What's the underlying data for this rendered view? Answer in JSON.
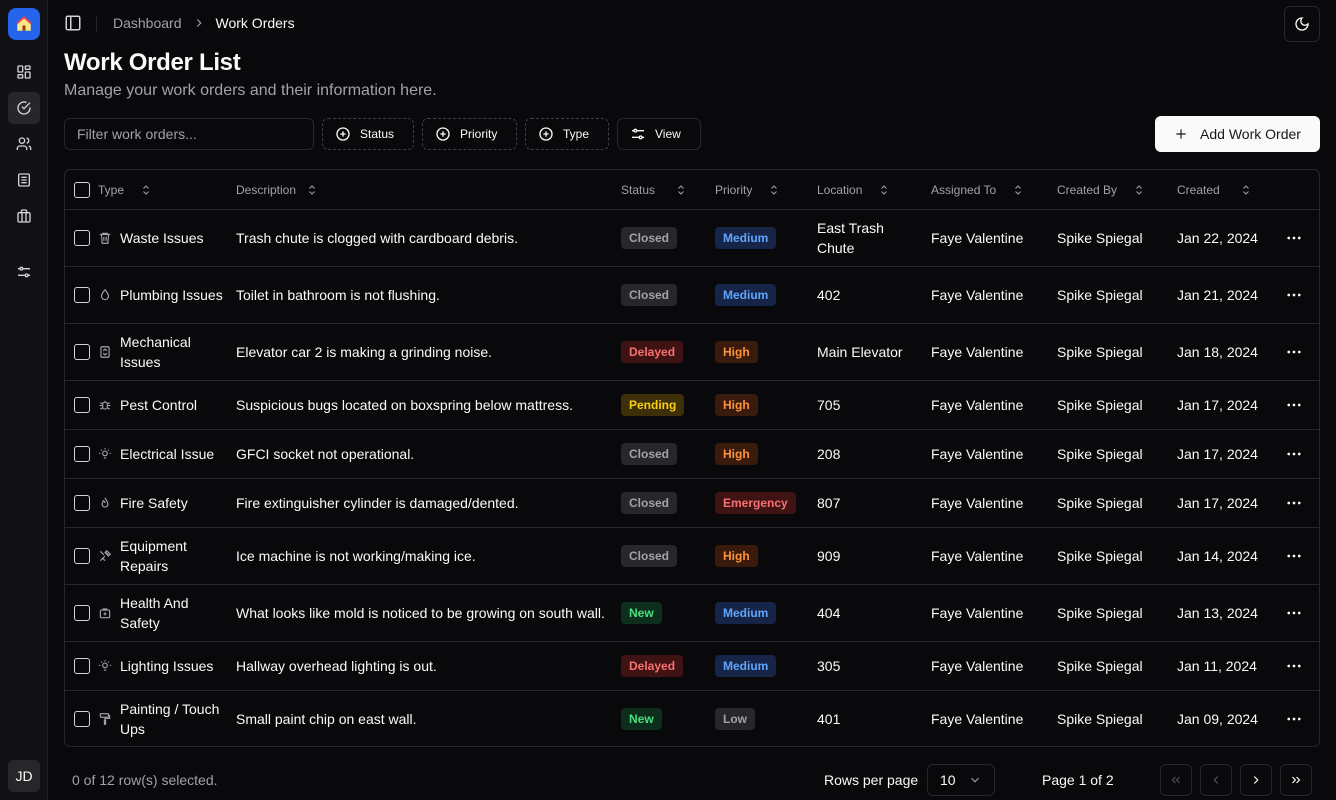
{
  "sidebar": {
    "user_initials": "JD",
    "items": [
      {
        "icon": "dashboard-icon"
      },
      {
        "icon": "circle-check-icon"
      },
      {
        "icon": "users-icon"
      },
      {
        "icon": "building-icon"
      },
      {
        "icon": "briefcase-icon"
      },
      {
        "icon": "sliders-icon"
      }
    ]
  },
  "breadcrumb": {
    "parent": "Dashboard",
    "current": "Work Orders"
  },
  "page": {
    "title": "Work Order List",
    "subtitle": "Manage your work orders and their information here."
  },
  "toolbar": {
    "filter_placeholder": "Filter work orders...",
    "status_label": "Status",
    "priority_label": "Priority",
    "type_label": "Type",
    "view_label": "View",
    "add_label": "Add Work Order"
  },
  "table": {
    "columns": [
      "Type",
      "Description",
      "Status",
      "Priority",
      "Location",
      "Assigned To",
      "Created By",
      "Created"
    ],
    "rows": [
      {
        "type": "Waste Issues",
        "icon": "trash-icon",
        "description": "Trash chute is clogged with cardboard debris.",
        "status": "Closed",
        "priority": "Medium",
        "location": "East Trash Chute",
        "assigned": "Faye Valentine",
        "created_by": "Spike Spiegal",
        "created": "Jan 22, 2024"
      },
      {
        "type": "Plumbing Issues",
        "icon": "droplet-icon",
        "description": "Toilet in bathroom is not flushing.",
        "status": "Closed",
        "priority": "Medium",
        "location": "402",
        "assigned": "Faye Valentine",
        "created_by": "Spike Spiegal",
        "created": "Jan 21, 2024"
      },
      {
        "type": "Mechanical Issues",
        "icon": "elevator-icon",
        "description": "Elevator car 2 is making a grinding noise.",
        "status": "Delayed",
        "priority": "High",
        "location": "Main Elevator",
        "assigned": "Faye Valentine",
        "created_by": "Spike Spiegal",
        "created": "Jan 18, 2024"
      },
      {
        "type": "Pest Control",
        "icon": "bug-icon",
        "description": "Suspicious bugs located on boxspring below mattress.",
        "status": "Pending",
        "priority": "High",
        "location": "705",
        "assigned": "Faye Valentine",
        "created_by": "Spike Spiegal",
        "created": "Jan 17, 2024"
      },
      {
        "type": "Electrical Issue",
        "icon": "lightbulb-icon",
        "description": "GFCI socket not operational.",
        "status": "Closed",
        "priority": "High",
        "location": "208",
        "assigned": "Faye Valentine",
        "created_by": "Spike Spiegal",
        "created": "Jan 17, 2024"
      },
      {
        "type": "Fire Safety",
        "icon": "flame-icon",
        "description": "Fire extinguisher cylinder is damaged/dented.",
        "status": "Closed",
        "priority": "Emergency",
        "location": "807",
        "assigned": "Faye Valentine",
        "created_by": "Spike Spiegal",
        "created": "Jan 17, 2024"
      },
      {
        "type": "Equipment Repairs",
        "icon": "tools-icon",
        "description": "Ice machine is not working/making ice.",
        "status": "Closed",
        "priority": "High",
        "location": "909",
        "assigned": "Faye Valentine",
        "created_by": "Spike Spiegal",
        "created": "Jan 14, 2024"
      },
      {
        "type": "Health And Safety",
        "icon": "first-aid-icon",
        "description": "What looks like mold is noticed to be growing on south wall.",
        "status": "New",
        "priority": "Medium",
        "location": "404",
        "assigned": "Faye Valentine",
        "created_by": "Spike Spiegal",
        "created": "Jan 13, 2024"
      },
      {
        "type": "Lighting Issues",
        "icon": "lightbulb-icon",
        "description": "Hallway overhead lighting is out.",
        "status": "Delayed",
        "priority": "Medium",
        "location": "305",
        "assigned": "Faye Valentine",
        "created_by": "Spike Spiegal",
        "created": "Jan 11, 2024"
      },
      {
        "type": "Painting / Touch Ups",
        "icon": "paint-roller-icon",
        "description": "Small paint chip on east wall.",
        "status": "New",
        "priority": "Low",
        "location": "401",
        "assigned": "Faye Valentine",
        "created_by": "Spike Spiegal",
        "created": "Jan 09, 2024"
      }
    ]
  },
  "badge_colors": {
    "Closed": {
      "bg": "#27272a",
      "fg": "#a1a1aa"
    },
    "Delayed": {
      "bg": "#3f1214",
      "fg": "#f87171"
    },
    "Pending": {
      "bg": "#3d3008",
      "fg": "#facc15"
    },
    "New": {
      "bg": "#0d2e1c",
      "fg": "#4ade80"
    },
    "Medium": {
      "bg": "#162447",
      "fg": "#60a5fa"
    },
    "High": {
      "bg": "#3a1a0c",
      "fg": "#fb923c"
    },
    "Emergency": {
      "bg": "#3f1214",
      "fg": "#f87171"
    },
    "Low": {
      "bg": "#27272a",
      "fg": "#a1a1aa"
    }
  },
  "footer": {
    "selection": "0 of 12 row(s) selected.",
    "rows_per_page_label": "Rows per page",
    "rows_per_page": "10",
    "page_info": "Page 1 of 2"
  }
}
